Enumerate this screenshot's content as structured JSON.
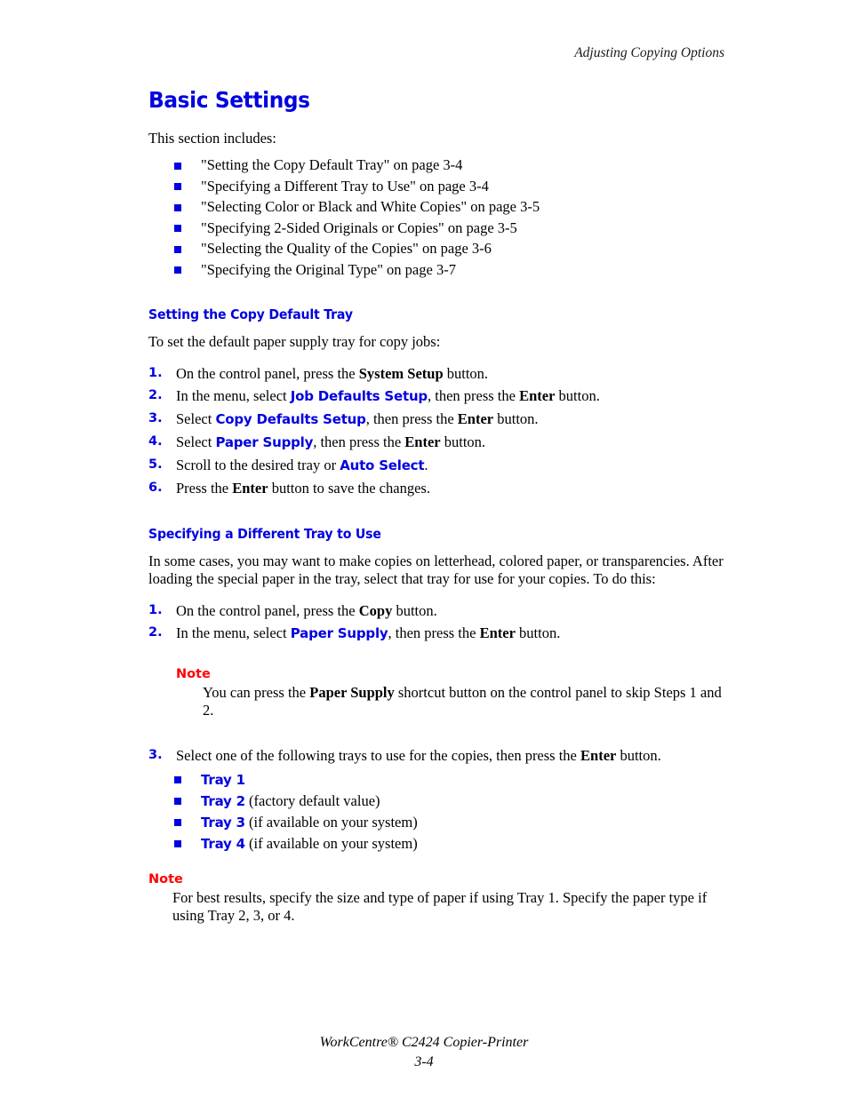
{
  "header": {
    "running_head": "Adjusting Copying Options"
  },
  "page_title": "Basic Settings",
  "intro": "This section includes:",
  "toc_items": [
    "\"Setting the Copy Default Tray\" on page 3-4",
    "\"Specifying a Different Tray to Use\" on page 3-4",
    "\"Selecting Color or Black and White Copies\" on page 3-5",
    "\"Specifying 2-Sided Originals or Copies\" on page 3-5",
    "\"Selecting the Quality of the Copies\" on page 3-6",
    "\"Specifying the Original Type\" on page 3-7"
  ],
  "section1": {
    "heading": "Setting the Copy Default Tray",
    "lead": "To set the default paper supply tray for copy jobs:",
    "steps": [
      {
        "num": "1.",
        "pre": "On the control panel, press the ",
        "bold": "System Setup",
        "post": " button."
      },
      {
        "num": "2.",
        "pre": "In the menu, select ",
        "ui": "Job Defaults Setup",
        "mid": ", then press the ",
        "bold": "Enter",
        "post": " button."
      },
      {
        "num": "3.",
        "pre": "Select ",
        "ui": "Copy Defaults Setup",
        "mid": ", then press the ",
        "bold": "Enter",
        "post": " button."
      },
      {
        "num": "4.",
        "pre": "Select ",
        "ui": "Paper Supply",
        "mid": ", then press the ",
        "bold": "Enter",
        "post": " button."
      },
      {
        "num": "5.",
        "pre": "Scroll to the desired tray or ",
        "ui": "Auto Select",
        "post": "."
      },
      {
        "num": "6.",
        "pre": "Press the ",
        "bold": "Enter",
        "post": " button to save the changes."
      }
    ]
  },
  "section2": {
    "heading": "Specifying a Different Tray to Use",
    "lead": "In some cases, you may want to make copies on letterhead, colored paper, or transparencies. After loading the special paper in the tray, select that tray for use for your copies. To do this:",
    "steps": [
      {
        "num": "1.",
        "pre": "On the control panel, press the ",
        "bold": "Copy",
        "post": " button."
      },
      {
        "num": "2.",
        "pre": "In the menu, select ",
        "ui": "Paper Supply",
        "mid": ", then press the ",
        "bold": "Enter",
        "post": " button."
      }
    ],
    "note1": {
      "label": "Note",
      "pre": "You can press the ",
      "bold": "Paper Supply",
      "post": " shortcut button on the control panel to skip Steps 1 and 2."
    },
    "step3": {
      "num": "3.",
      "pre": "Select one of the following trays to use for the copies, then press the ",
      "bold": "Enter",
      "post": " button."
    },
    "trays": [
      {
        "label": "Tray 1",
        "note": ""
      },
      {
        "label": "Tray 2",
        "note": " (factory default value)"
      },
      {
        "label": "Tray 3",
        "note": " (if available on your system)"
      },
      {
        "label": "Tray 4",
        "note": " (if available on your system)"
      }
    ],
    "note2": {
      "label": "Note",
      "text": "For best results, specify the size and type of paper if using Tray 1. Specify the paper type if using Tray 2, 3, or 4."
    }
  },
  "footer": {
    "product": "WorkCentre® C2424 Copier-Printer",
    "page_number": "3-4"
  },
  "colors": {
    "accent_blue": "#0000E0",
    "note_red": "#FF0000",
    "text_black": "#000000"
  }
}
